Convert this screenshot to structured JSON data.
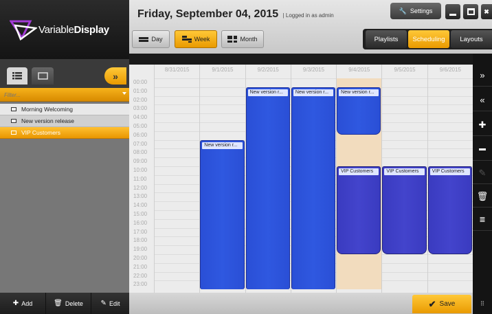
{
  "app": {
    "brand_light": "Variable",
    "brand_bold": "Display"
  },
  "left": {
    "filter_placeholder": "Filter...",
    "playlists": [
      {
        "label": "Morning Welcoming",
        "selected": false
      },
      {
        "label": "New version release",
        "selected": false
      },
      {
        "label": "VIP Customers",
        "selected": true
      }
    ],
    "add_label": "Add",
    "delete_label": "Delete",
    "edit_label": "Edit"
  },
  "header": {
    "date_title": "Friday, September 04, 2015",
    "logged_in": "| Logged in as admin",
    "settings_label": "Settings",
    "views": {
      "day": "Day",
      "week": "Week",
      "month": "Month"
    },
    "tabs": {
      "playlists": "Playlists",
      "scheduling": "Scheduling",
      "layouts": "Layouts"
    }
  },
  "calendar": {
    "days": [
      "8/31/2015",
      "9/1/2015",
      "9/2/2015",
      "9/3/2015",
      "9/4/2015",
      "9/5/2015",
      "9/6/2015"
    ],
    "hours": [
      "00:00",
      "01:00",
      "02:00",
      "03:00",
      "04:00",
      "05:00",
      "06:00",
      "07:00",
      "08:00",
      "09:00",
      "10:00",
      "11:00",
      "12:00",
      "13:00",
      "14:00",
      "15:00",
      "16:00",
      "17:00",
      "18:00",
      "19:00",
      "20:00",
      "21:00",
      "22:00",
      "23:00"
    ],
    "events": [
      {
        "day": 1,
        "start": 7,
        "end": 24,
        "label": "New version r...",
        "kind": "version",
        "rounded": false
      },
      {
        "day": 2,
        "start": 1,
        "end": 24,
        "label": "New version r...",
        "kind": "version",
        "rounded": false
      },
      {
        "day": 3,
        "start": 1,
        "end": 24,
        "label": "New version r...",
        "kind": "version",
        "rounded": false
      },
      {
        "day": 4,
        "start": 1,
        "end": 6.4,
        "label": "New version r...",
        "kind": "version",
        "rounded": true
      },
      {
        "day": 4,
        "start": 10,
        "end": 20,
        "label": "VIP Customers",
        "kind": "vip",
        "rounded": true
      },
      {
        "day": 5,
        "start": 10,
        "end": 20,
        "label": "VIP Customers",
        "kind": "vip",
        "rounded": true
      },
      {
        "day": 6,
        "start": 10,
        "end": 20,
        "label": "VIP Customers",
        "kind": "vip",
        "rounded": true
      }
    ],
    "today_index": 4
  },
  "footer": {
    "save_label": "Save"
  },
  "colors": {
    "accent": "#f2a60e",
    "event_blue": "#2f58e0",
    "event_vip": "#4344cc",
    "today_bg": "#f2dcbe"
  },
  "icons": [
    "logo-icon",
    "list-view-icon",
    "screen-view-icon",
    "chevron-double-right-icon",
    "wrench-icon",
    "minimize-icon",
    "maximize-icon",
    "close-icon",
    "plus-icon",
    "trash-icon",
    "pencil-icon",
    "check-icon",
    "chevron-double-left-icon",
    "minus-icon",
    "resize-grip-icon"
  ]
}
